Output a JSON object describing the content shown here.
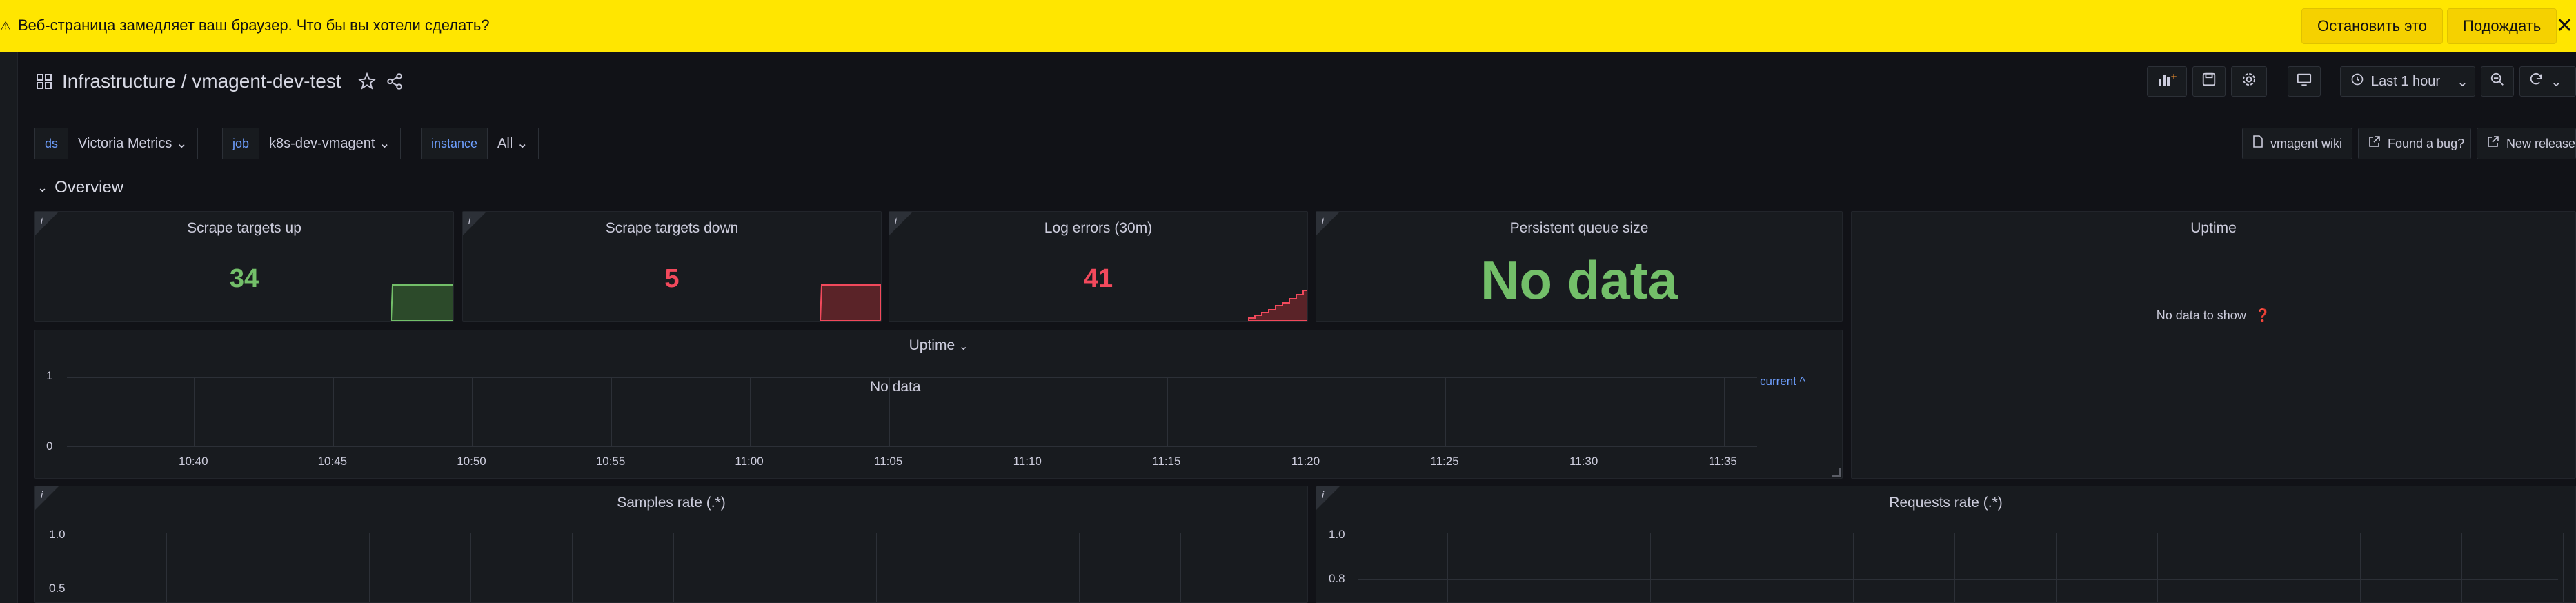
{
  "warning": {
    "message": "Веб-страница замедляет ваш браузер. Что бы вы хотели сделать?",
    "stop_label": "Остановить это",
    "wait_label": "Подождать",
    "close_symbol": "✕"
  },
  "header": {
    "title": "Infrastructure / vmagent-dev-test",
    "time_range": "Last 1 hour"
  },
  "variables": [
    {
      "label": "ds",
      "value": "Victoria Metrics"
    },
    {
      "label": "job",
      "value": "k8s-dev-vmagent"
    },
    {
      "label": "instance",
      "value": "All"
    }
  ],
  "links": {
    "wiki": "vmagent wiki",
    "bug": "Found a bug?",
    "releases": "New releases"
  },
  "row": {
    "title": "Overview"
  },
  "panels": {
    "targets_up": {
      "title": "Scrape targets up",
      "value": "34",
      "color": "#73bf69"
    },
    "targets_down": {
      "title": "Scrape targets down",
      "value": "5",
      "color": "#f2495c"
    },
    "log_errors": {
      "title": "Log errors (30m)",
      "value": "41",
      "color": "#f2495c"
    },
    "queue_size": {
      "title": "Persistent queue size",
      "value": "No data",
      "color": "#73bf69"
    },
    "uptime_right": {
      "title": "Uptime",
      "message": "No data to show"
    },
    "uptime_graph": {
      "title": "Uptime",
      "no_data": "No data",
      "legend": "current"
    },
    "samples_rate": {
      "title": "Samples rate (.*)"
    },
    "requests_rate": {
      "title": "Requests rate (.*)"
    }
  },
  "chart_data": [
    {
      "type": "line",
      "title": "Uptime",
      "x": [
        "10:40",
        "10:45",
        "10:50",
        "10:55",
        "11:00",
        "11:05",
        "11:10",
        "11:15",
        "11:20",
        "11:25",
        "11:30",
        "11:35"
      ],
      "y_ticks": [
        "1",
        "0"
      ],
      "series": [],
      "note": "No data"
    },
    {
      "type": "line",
      "title": "Samples rate (.*)",
      "y_ticks": [
        "1.0",
        "0.5"
      ],
      "series": []
    },
    {
      "type": "line",
      "title": "Requests rate (.*)",
      "y_ticks": [
        "1.0",
        "0.8"
      ],
      "series": []
    }
  ]
}
